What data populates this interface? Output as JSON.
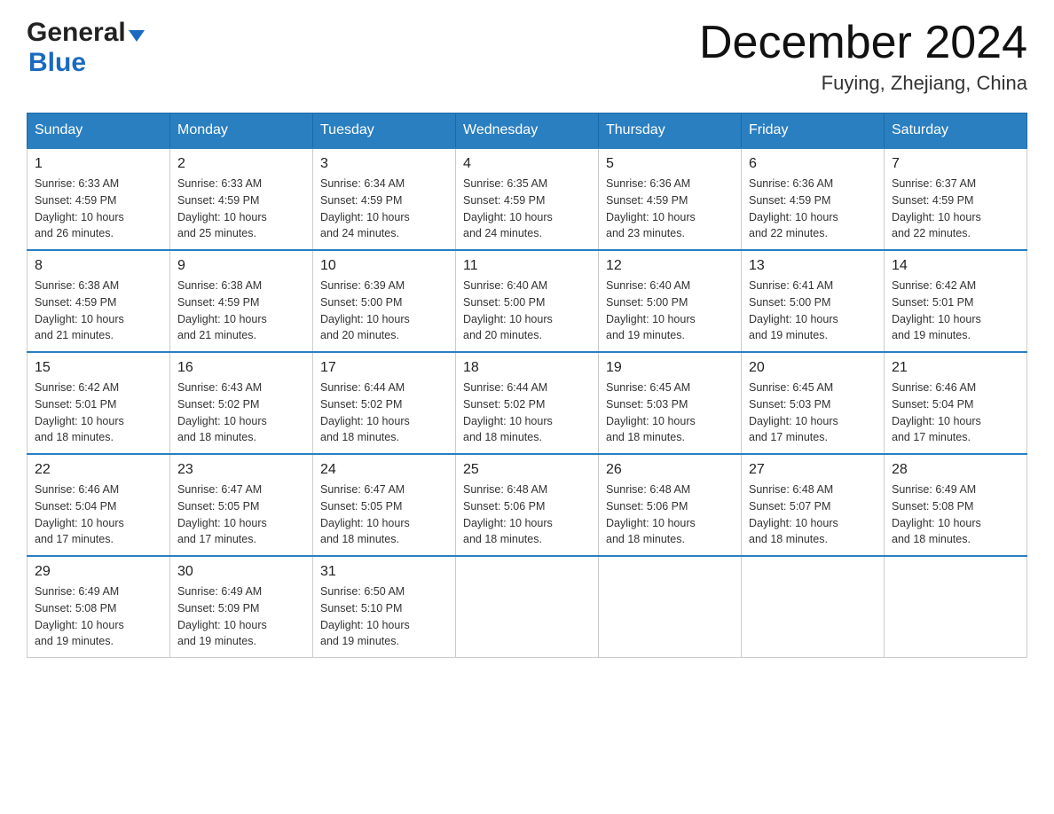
{
  "header": {
    "logo_general": "General",
    "logo_blue": "Blue",
    "month_title": "December 2024",
    "location": "Fuying, Zhejiang, China"
  },
  "columns": [
    "Sunday",
    "Monday",
    "Tuesday",
    "Wednesday",
    "Thursday",
    "Friday",
    "Saturday"
  ],
  "weeks": [
    [
      {
        "day": "1",
        "info": "Sunrise: 6:33 AM\nSunset: 4:59 PM\nDaylight: 10 hours\nand 26 minutes."
      },
      {
        "day": "2",
        "info": "Sunrise: 6:33 AM\nSunset: 4:59 PM\nDaylight: 10 hours\nand 25 minutes."
      },
      {
        "day": "3",
        "info": "Sunrise: 6:34 AM\nSunset: 4:59 PM\nDaylight: 10 hours\nand 24 minutes."
      },
      {
        "day": "4",
        "info": "Sunrise: 6:35 AM\nSunset: 4:59 PM\nDaylight: 10 hours\nand 24 minutes."
      },
      {
        "day": "5",
        "info": "Sunrise: 6:36 AM\nSunset: 4:59 PM\nDaylight: 10 hours\nand 23 minutes."
      },
      {
        "day": "6",
        "info": "Sunrise: 6:36 AM\nSunset: 4:59 PM\nDaylight: 10 hours\nand 22 minutes."
      },
      {
        "day": "7",
        "info": "Sunrise: 6:37 AM\nSunset: 4:59 PM\nDaylight: 10 hours\nand 22 minutes."
      }
    ],
    [
      {
        "day": "8",
        "info": "Sunrise: 6:38 AM\nSunset: 4:59 PM\nDaylight: 10 hours\nand 21 minutes."
      },
      {
        "day": "9",
        "info": "Sunrise: 6:38 AM\nSunset: 4:59 PM\nDaylight: 10 hours\nand 21 minutes."
      },
      {
        "day": "10",
        "info": "Sunrise: 6:39 AM\nSunset: 5:00 PM\nDaylight: 10 hours\nand 20 minutes."
      },
      {
        "day": "11",
        "info": "Sunrise: 6:40 AM\nSunset: 5:00 PM\nDaylight: 10 hours\nand 20 minutes."
      },
      {
        "day": "12",
        "info": "Sunrise: 6:40 AM\nSunset: 5:00 PM\nDaylight: 10 hours\nand 19 minutes."
      },
      {
        "day": "13",
        "info": "Sunrise: 6:41 AM\nSunset: 5:00 PM\nDaylight: 10 hours\nand 19 minutes."
      },
      {
        "day": "14",
        "info": "Sunrise: 6:42 AM\nSunset: 5:01 PM\nDaylight: 10 hours\nand 19 minutes."
      }
    ],
    [
      {
        "day": "15",
        "info": "Sunrise: 6:42 AM\nSunset: 5:01 PM\nDaylight: 10 hours\nand 18 minutes."
      },
      {
        "day": "16",
        "info": "Sunrise: 6:43 AM\nSunset: 5:02 PM\nDaylight: 10 hours\nand 18 minutes."
      },
      {
        "day": "17",
        "info": "Sunrise: 6:44 AM\nSunset: 5:02 PM\nDaylight: 10 hours\nand 18 minutes."
      },
      {
        "day": "18",
        "info": "Sunrise: 6:44 AM\nSunset: 5:02 PM\nDaylight: 10 hours\nand 18 minutes."
      },
      {
        "day": "19",
        "info": "Sunrise: 6:45 AM\nSunset: 5:03 PM\nDaylight: 10 hours\nand 18 minutes."
      },
      {
        "day": "20",
        "info": "Sunrise: 6:45 AM\nSunset: 5:03 PM\nDaylight: 10 hours\nand 17 minutes."
      },
      {
        "day": "21",
        "info": "Sunrise: 6:46 AM\nSunset: 5:04 PM\nDaylight: 10 hours\nand 17 minutes."
      }
    ],
    [
      {
        "day": "22",
        "info": "Sunrise: 6:46 AM\nSunset: 5:04 PM\nDaylight: 10 hours\nand 17 minutes."
      },
      {
        "day": "23",
        "info": "Sunrise: 6:47 AM\nSunset: 5:05 PM\nDaylight: 10 hours\nand 17 minutes."
      },
      {
        "day": "24",
        "info": "Sunrise: 6:47 AM\nSunset: 5:05 PM\nDaylight: 10 hours\nand 18 minutes."
      },
      {
        "day": "25",
        "info": "Sunrise: 6:48 AM\nSunset: 5:06 PM\nDaylight: 10 hours\nand 18 minutes."
      },
      {
        "day": "26",
        "info": "Sunrise: 6:48 AM\nSunset: 5:06 PM\nDaylight: 10 hours\nand 18 minutes."
      },
      {
        "day": "27",
        "info": "Sunrise: 6:48 AM\nSunset: 5:07 PM\nDaylight: 10 hours\nand 18 minutes."
      },
      {
        "day": "28",
        "info": "Sunrise: 6:49 AM\nSunset: 5:08 PM\nDaylight: 10 hours\nand 18 minutes."
      }
    ],
    [
      {
        "day": "29",
        "info": "Sunrise: 6:49 AM\nSunset: 5:08 PM\nDaylight: 10 hours\nand 19 minutes."
      },
      {
        "day": "30",
        "info": "Sunrise: 6:49 AM\nSunset: 5:09 PM\nDaylight: 10 hours\nand 19 minutes."
      },
      {
        "day": "31",
        "info": "Sunrise: 6:50 AM\nSunset: 5:10 PM\nDaylight: 10 hours\nand 19 minutes."
      },
      {
        "day": "",
        "info": ""
      },
      {
        "day": "",
        "info": ""
      },
      {
        "day": "",
        "info": ""
      },
      {
        "day": "",
        "info": ""
      }
    ]
  ]
}
